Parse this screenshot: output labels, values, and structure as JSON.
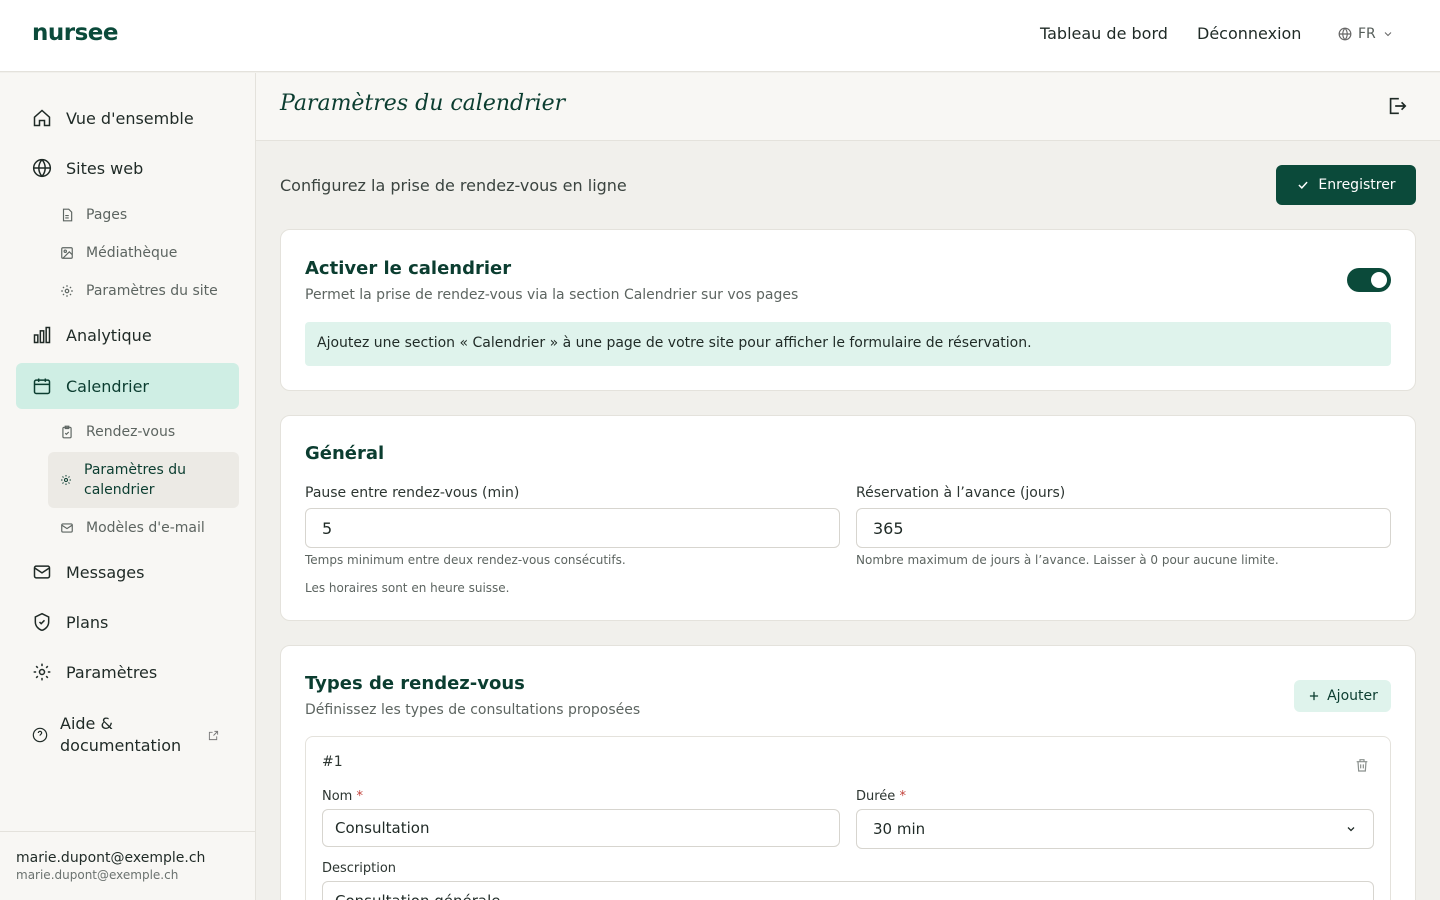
{
  "header": {
    "logo": "nursee",
    "nav": [
      "Tableau de bord",
      "Déconnexion"
    ],
    "language": "FR"
  },
  "sidebar": {
    "items": [
      {
        "label": "Vue d'ensemble",
        "icon": "home-icon"
      },
      {
        "label": "Sites web",
        "icon": "globe-icon"
      },
      {
        "label": "Pages",
        "icon": "file-icon"
      },
      {
        "label": "Médiathèque",
        "icon": "image-icon"
      },
      {
        "label": "Paramètres du site",
        "icon": "gear-icon"
      },
      {
        "label": "Analytique",
        "icon": "bar-chart-icon"
      },
      {
        "label": "Calendrier",
        "icon": "calendar-icon"
      },
      {
        "label": "Rendez-vous",
        "icon": "clipboard-icon"
      },
      {
        "label": "Paramètres du calendrier",
        "icon": "gear-icon"
      },
      {
        "label": "Modèles d'e-mail",
        "icon": "mail-icon"
      },
      {
        "label": "Messages",
        "icon": "mail-icon"
      },
      {
        "label": "Plans",
        "icon": "shield-icon"
      },
      {
        "label": "Paramètres",
        "icon": "gear-icon"
      },
      {
        "label": "Aide & documentation",
        "icon": "help-icon"
      }
    ],
    "active": "Calendrier",
    "active_sub": "Paramètres du calendrier",
    "user": {
      "email": "marie.dupont@exemple.ch",
      "email_sub": "marie.dupont@exemple.ch"
    }
  },
  "page": {
    "title": "Paramètres du calendrier",
    "intro": "Configurez la prise de rendez-vous en ligne",
    "save_label": "Enregistrer"
  },
  "activate_card": {
    "title": "Activer le calendrier",
    "subtitle": "Permet la prise de rendez-vous via la section Calendrier sur vos pages",
    "enabled": true,
    "info": "Ajoutez une section « Calendrier » à une page de votre site pour afficher le formulaire de réservation."
  },
  "general_card": {
    "title": "Général",
    "pause_label": "Pause entre rendez-vous (min)",
    "pause_value": "5",
    "pause_hint": "Temps minimum entre deux rendez-vous consécutifs.",
    "advance_label": "Réservation à l’avance (jours)",
    "advance_value": "365",
    "advance_hint": "Nombre maximum de jours à l’avance. Laisser à 0 pour aucune limite.",
    "timezone_note": "Les horaires sont en heure suisse."
  },
  "types_card": {
    "title": "Types de rendez-vous",
    "subtitle": "Définissez les types de consultations proposées",
    "add_label": "Ajouter",
    "items": [
      {
        "index": "#1",
        "name_label": "Nom",
        "name_value": "Consultation",
        "duration_label": "Durée",
        "duration_value": "30 min",
        "description_label": "Description",
        "description_value": "Consultation générale"
      }
    ]
  },
  "colors": {
    "brand": "#0b4a3a",
    "accent_light": "#dff3ec",
    "active_nav": "#cfeee4"
  }
}
